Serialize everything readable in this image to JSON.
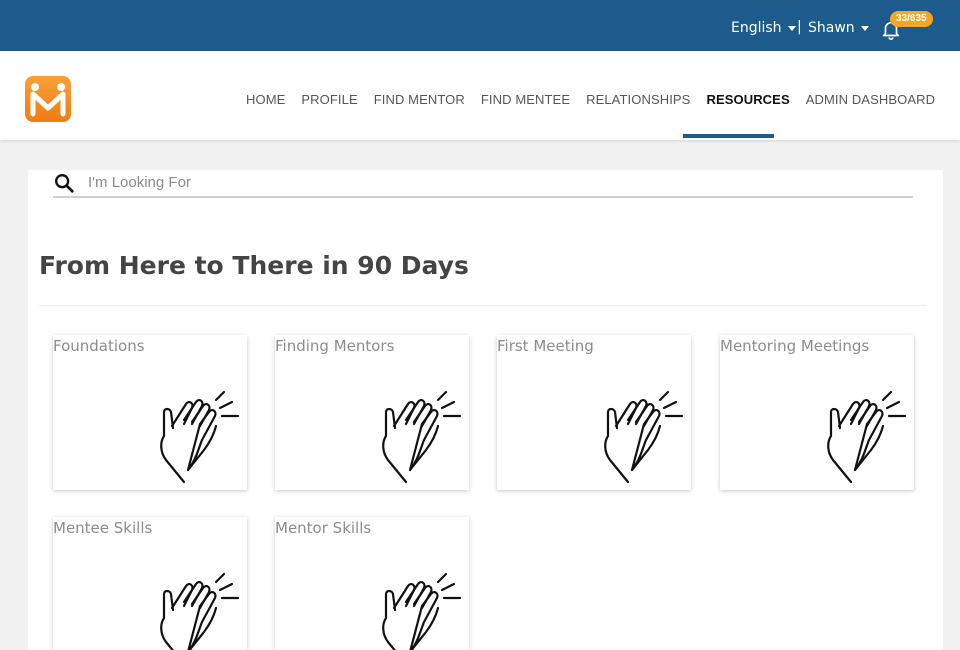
{
  "topbar": {
    "language": "English",
    "user": "Shawn",
    "separator": "|",
    "notification_count": "33/635"
  },
  "nav": {
    "items": [
      "HOME",
      "PROFILE",
      "FIND MENTOR",
      "FIND MENTEE",
      "RELATIONSHIPS",
      "RESOURCES",
      "ADMIN DASHBOARD"
    ],
    "active": "RESOURCES"
  },
  "search": {
    "placeholder": "I'm Looking For"
  },
  "section": {
    "title": "From Here to There in 90 Days"
  },
  "cards": [
    {
      "title": "Foundations",
      "icon": "clapping-hands-icon"
    },
    {
      "title": "Finding Mentors",
      "icon": "clapping-hands-icon"
    },
    {
      "title": "First Meeting",
      "icon": "clapping-hands-icon"
    },
    {
      "title": "Mentoring Meetings",
      "icon": "clapping-hands-icon"
    },
    {
      "title": "Mentee Skills",
      "icon": "clapping-hands-icon"
    },
    {
      "title": "Mentor Skills",
      "icon": "clapping-hands-icon"
    }
  ],
  "colors": {
    "topbar": "#1c5b8c",
    "accent": "#1c5b8c",
    "badge": "#f5a623",
    "logo": "#f38a1f"
  }
}
